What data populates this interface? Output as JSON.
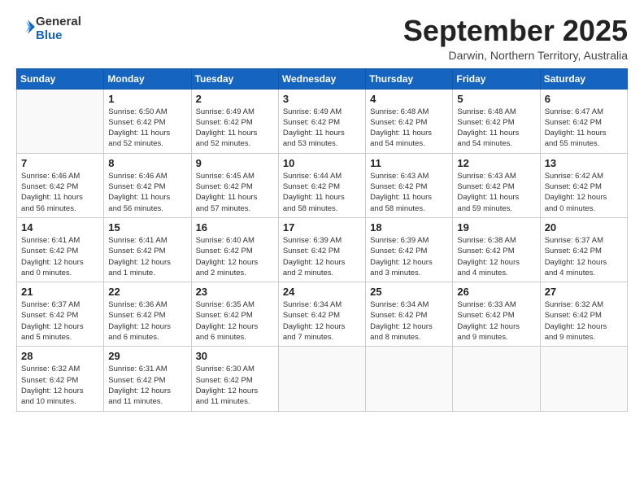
{
  "logo": {
    "line1": "General",
    "line2": "Blue"
  },
  "title": "September 2025",
  "subtitle": "Darwin, Northern Territory, Australia",
  "days_header": [
    "Sunday",
    "Monday",
    "Tuesday",
    "Wednesday",
    "Thursday",
    "Friday",
    "Saturday"
  ],
  "weeks": [
    [
      {
        "day": "",
        "info": ""
      },
      {
        "day": "1",
        "info": "Sunrise: 6:50 AM\nSunset: 6:42 PM\nDaylight: 11 hours\nand 52 minutes."
      },
      {
        "day": "2",
        "info": "Sunrise: 6:49 AM\nSunset: 6:42 PM\nDaylight: 11 hours\nand 52 minutes."
      },
      {
        "day": "3",
        "info": "Sunrise: 6:49 AM\nSunset: 6:42 PM\nDaylight: 11 hours\nand 53 minutes."
      },
      {
        "day": "4",
        "info": "Sunrise: 6:48 AM\nSunset: 6:42 PM\nDaylight: 11 hours\nand 54 minutes."
      },
      {
        "day": "5",
        "info": "Sunrise: 6:48 AM\nSunset: 6:42 PM\nDaylight: 11 hours\nand 54 minutes."
      },
      {
        "day": "6",
        "info": "Sunrise: 6:47 AM\nSunset: 6:42 PM\nDaylight: 11 hours\nand 55 minutes."
      }
    ],
    [
      {
        "day": "7",
        "info": "Sunrise: 6:46 AM\nSunset: 6:42 PM\nDaylight: 11 hours\nand 56 minutes."
      },
      {
        "day": "8",
        "info": "Sunrise: 6:46 AM\nSunset: 6:42 PM\nDaylight: 11 hours\nand 56 minutes."
      },
      {
        "day": "9",
        "info": "Sunrise: 6:45 AM\nSunset: 6:42 PM\nDaylight: 11 hours\nand 57 minutes."
      },
      {
        "day": "10",
        "info": "Sunrise: 6:44 AM\nSunset: 6:42 PM\nDaylight: 11 hours\nand 58 minutes."
      },
      {
        "day": "11",
        "info": "Sunrise: 6:43 AM\nSunset: 6:42 PM\nDaylight: 11 hours\nand 58 minutes."
      },
      {
        "day": "12",
        "info": "Sunrise: 6:43 AM\nSunset: 6:42 PM\nDaylight: 11 hours\nand 59 minutes."
      },
      {
        "day": "13",
        "info": "Sunrise: 6:42 AM\nSunset: 6:42 PM\nDaylight: 12 hours\nand 0 minutes."
      }
    ],
    [
      {
        "day": "14",
        "info": "Sunrise: 6:41 AM\nSunset: 6:42 PM\nDaylight: 12 hours\nand 0 minutes."
      },
      {
        "day": "15",
        "info": "Sunrise: 6:41 AM\nSunset: 6:42 PM\nDaylight: 12 hours\nand 1 minute."
      },
      {
        "day": "16",
        "info": "Sunrise: 6:40 AM\nSunset: 6:42 PM\nDaylight: 12 hours\nand 2 minutes."
      },
      {
        "day": "17",
        "info": "Sunrise: 6:39 AM\nSunset: 6:42 PM\nDaylight: 12 hours\nand 2 minutes."
      },
      {
        "day": "18",
        "info": "Sunrise: 6:39 AM\nSunset: 6:42 PM\nDaylight: 12 hours\nand 3 minutes."
      },
      {
        "day": "19",
        "info": "Sunrise: 6:38 AM\nSunset: 6:42 PM\nDaylight: 12 hours\nand 4 minutes."
      },
      {
        "day": "20",
        "info": "Sunrise: 6:37 AM\nSunset: 6:42 PM\nDaylight: 12 hours\nand 4 minutes."
      }
    ],
    [
      {
        "day": "21",
        "info": "Sunrise: 6:37 AM\nSunset: 6:42 PM\nDaylight: 12 hours\nand 5 minutes."
      },
      {
        "day": "22",
        "info": "Sunrise: 6:36 AM\nSunset: 6:42 PM\nDaylight: 12 hours\nand 6 minutes."
      },
      {
        "day": "23",
        "info": "Sunrise: 6:35 AM\nSunset: 6:42 PM\nDaylight: 12 hours\nand 6 minutes."
      },
      {
        "day": "24",
        "info": "Sunrise: 6:34 AM\nSunset: 6:42 PM\nDaylight: 12 hours\nand 7 minutes."
      },
      {
        "day": "25",
        "info": "Sunrise: 6:34 AM\nSunset: 6:42 PM\nDaylight: 12 hours\nand 8 minutes."
      },
      {
        "day": "26",
        "info": "Sunrise: 6:33 AM\nSunset: 6:42 PM\nDaylight: 12 hours\nand 9 minutes."
      },
      {
        "day": "27",
        "info": "Sunrise: 6:32 AM\nSunset: 6:42 PM\nDaylight: 12 hours\nand 9 minutes."
      }
    ],
    [
      {
        "day": "28",
        "info": "Sunrise: 6:32 AM\nSunset: 6:42 PM\nDaylight: 12 hours\nand 10 minutes."
      },
      {
        "day": "29",
        "info": "Sunrise: 6:31 AM\nSunset: 6:42 PM\nDaylight: 12 hours\nand 11 minutes."
      },
      {
        "day": "30",
        "info": "Sunrise: 6:30 AM\nSunset: 6:42 PM\nDaylight: 12 hours\nand 11 minutes."
      },
      {
        "day": "",
        "info": ""
      },
      {
        "day": "",
        "info": ""
      },
      {
        "day": "",
        "info": ""
      },
      {
        "day": "",
        "info": ""
      }
    ]
  ]
}
